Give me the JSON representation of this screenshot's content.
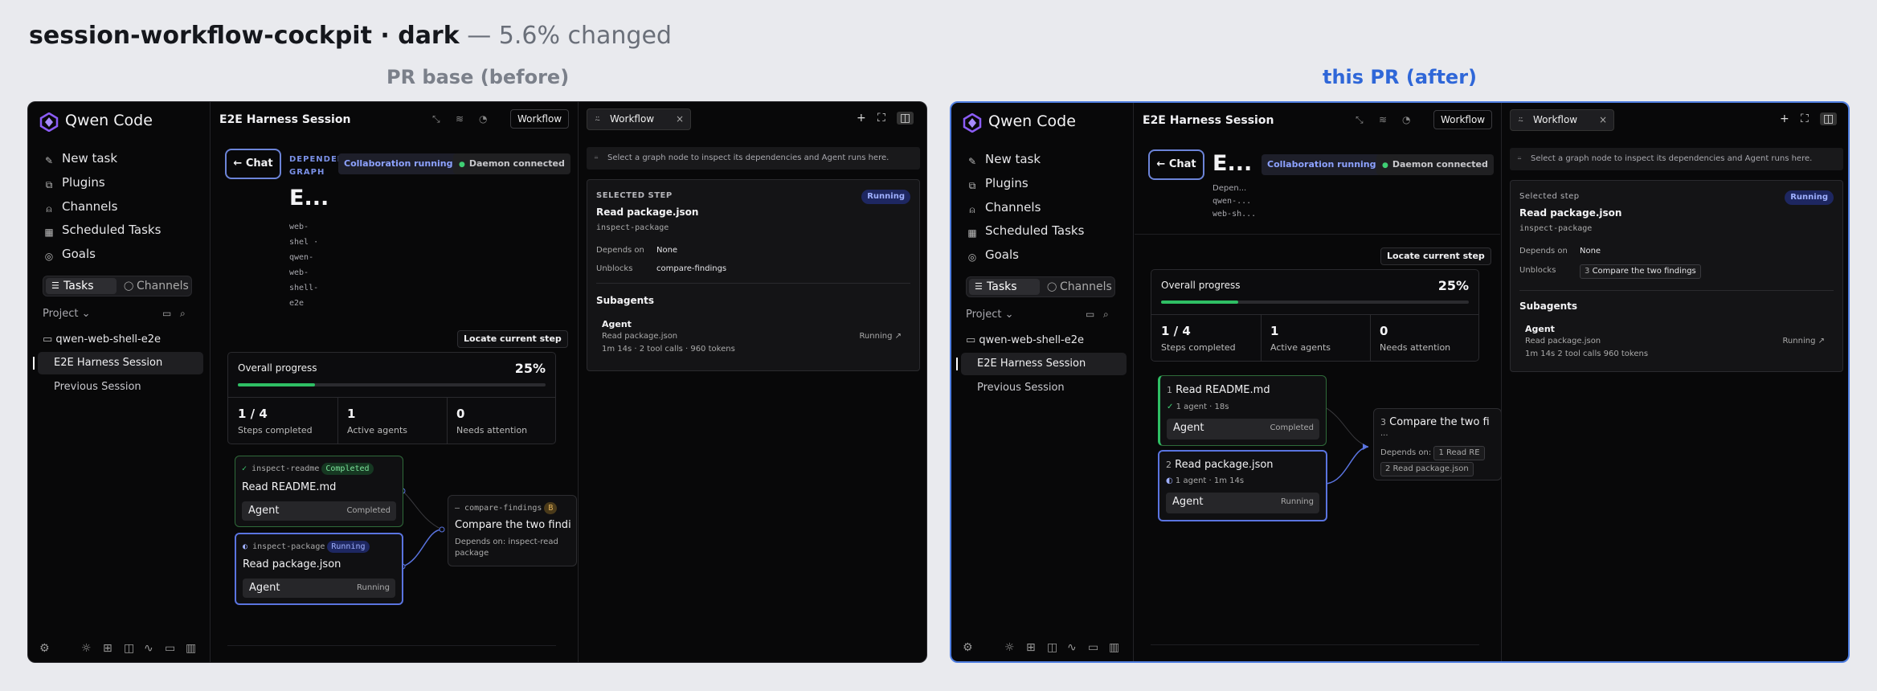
{
  "header": {
    "title_main": "session-workflow-cockpit · dark",
    "title_sep": " — ",
    "title_changed": "5.6% changed"
  },
  "labels": {
    "before": "PR base (before)",
    "after": "this PR (after)"
  },
  "sidebar": {
    "app_name": "Qwen Code",
    "nav": [
      "New task",
      "Plugins",
      "Channels",
      "Scheduled Tasks",
      "Goals"
    ],
    "seg_tasks": "Tasks",
    "seg_channels": "Channels",
    "project_label": "Project",
    "project_name": "qwen-web-shell-e2e",
    "sessions": [
      "E2E Harness Session",
      "Previous Session"
    ]
  },
  "center": {
    "session_title": "E2E Harness Session",
    "workflow_button": "Workflow",
    "chat_button": "Chat",
    "collab_chip": "Collaboration running",
    "daemon_chip": "Daemon connected",
    "dep_graph_label": "DEPENDENCY GRAPH",
    "big_title": "E...",
    "before_vertical": [
      "web-",
      "shel ·",
      "qwen-",
      "web-",
      "shell-",
      "e2e"
    ],
    "after_lines": [
      "Depen...",
      "qwen-...",
      "web-sh..."
    ],
    "locate_button": "Locate current step",
    "progress": {
      "label": "Overall progress",
      "value": "25%",
      "fraction": 0.25,
      "stats": [
        {
          "n": "1 / 4",
          "d": "Steps completed"
        },
        {
          "n": "1",
          "d": "Active agents"
        },
        {
          "n": "0",
          "d": "Needs attention"
        }
      ]
    },
    "before_nodes": {
      "n1": {
        "id": "inspect-readme",
        "status": "Completed",
        "title": "Read README.md",
        "agent": "Agent",
        "agent_status": "Completed"
      },
      "n2": {
        "id": "inspect-package",
        "status": "Running",
        "title": "Read package.json",
        "agent": "Agent",
        "agent_status": "Running"
      },
      "n3": {
        "id": "compare-findings",
        "title": "Compare the two findi",
        "deps": "Depends on: inspect-read",
        "deps2": "package"
      }
    },
    "after_nodes": {
      "n1": {
        "num": "1",
        "title": "Read README.md",
        "meta": "1 agent · 18s",
        "agent": "Agent",
        "agent_status": "Completed"
      },
      "n2": {
        "num": "2",
        "title": "Read package.json",
        "meta": "1 agent · 1m 14s",
        "agent": "Agent",
        "agent_status": "Running"
      },
      "n3": {
        "num": "3",
        "title": "Compare the two fi",
        "ellipsis": "...",
        "deps_label": "Depends on:",
        "dep1": "1  Read RE",
        "dep2": "2  Read package.json"
      }
    }
  },
  "right": {
    "tab": "Workflow",
    "hint": "Select a graph node to inspect its dependencies and Agent runs here.",
    "selected_before": "SELECTED STEP",
    "selected_after": "Selected step",
    "step_name": "Read package.json",
    "step_id": "inspect-package",
    "status": "Running",
    "depends_label": "Depends on",
    "depends_value": "None",
    "unblocks_label": "Unblocks",
    "unblocks_before": "compare-findings",
    "unblocks_after_num": "3",
    "unblocks_after": "Compare the two findings",
    "subagents": "Subagents",
    "agent": "Agent",
    "agent_file": "Read package.json",
    "agent_meta_before": "1m 14s · 2 tool calls · 960 tokens",
    "agent_meta_after": "1m 14s   2 tool calls   960 tokens",
    "agent_status": "Running"
  },
  "colors": {
    "accent": "#4f7ee0",
    "success": "#2fbf64",
    "running": "#9fb0ff",
    "bg": "#080809"
  },
  "icons": [
    "logo-icon",
    "task-icon",
    "plugin-icon",
    "channel-icon",
    "calendar-icon",
    "target-icon",
    "list-icon",
    "chat-bubble-icon",
    "folder-icon",
    "search-icon",
    "gear-icon",
    "sun-icon",
    "grid-icon",
    "split-icon",
    "activity-icon",
    "sidebar-icon",
    "workflow-icon",
    "close-icon",
    "plus-icon",
    "expand-icon",
    "panel-icon",
    "back-arrow-icon",
    "link-arrow-icon"
  ]
}
